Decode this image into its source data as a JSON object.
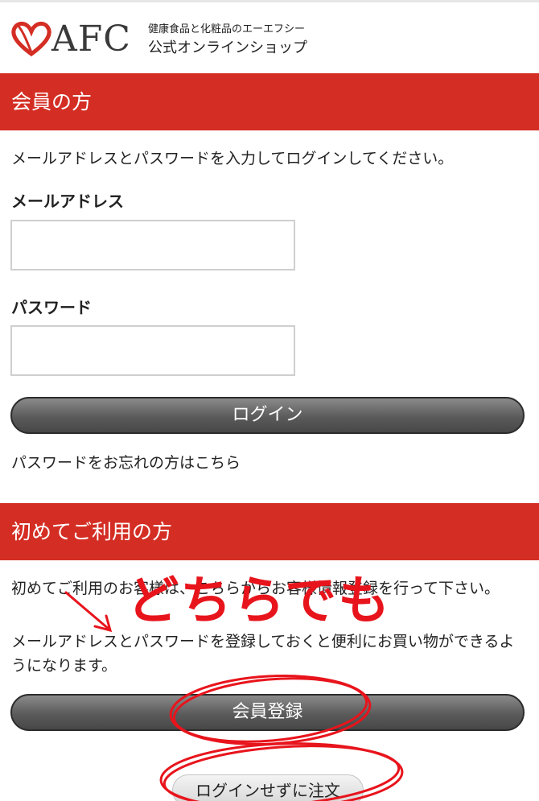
{
  "brand": {
    "logo_text": "AFC",
    "tagline": "健康食品と化粧品のエーエフシー",
    "shop_name": "公式オンラインショップ",
    "accent_color": "#d42e24"
  },
  "member_section": {
    "title": "会員の方",
    "instruction": "メールアドレスとパスワードを入力してログインしてください。",
    "email_label": "メールアドレス",
    "email_value": "",
    "password_label": "パスワード",
    "password_value": "",
    "login_button": "ログイン",
    "forgot_link": "パスワードをお忘れの方はこちら"
  },
  "first_time_section": {
    "title": "初めてご利用の方",
    "description_1": "初めてご利用のお客様は、こちらからお客様情報登録を行って下さい。",
    "description_2": "メールアドレスとパスワードを登録しておくと便利にお買い物ができるようになります。",
    "register_button": "会員登録",
    "guest_button": "ログインせずに注文"
  },
  "annotation": {
    "text": "どちらでも",
    "color": "#e8141c"
  }
}
